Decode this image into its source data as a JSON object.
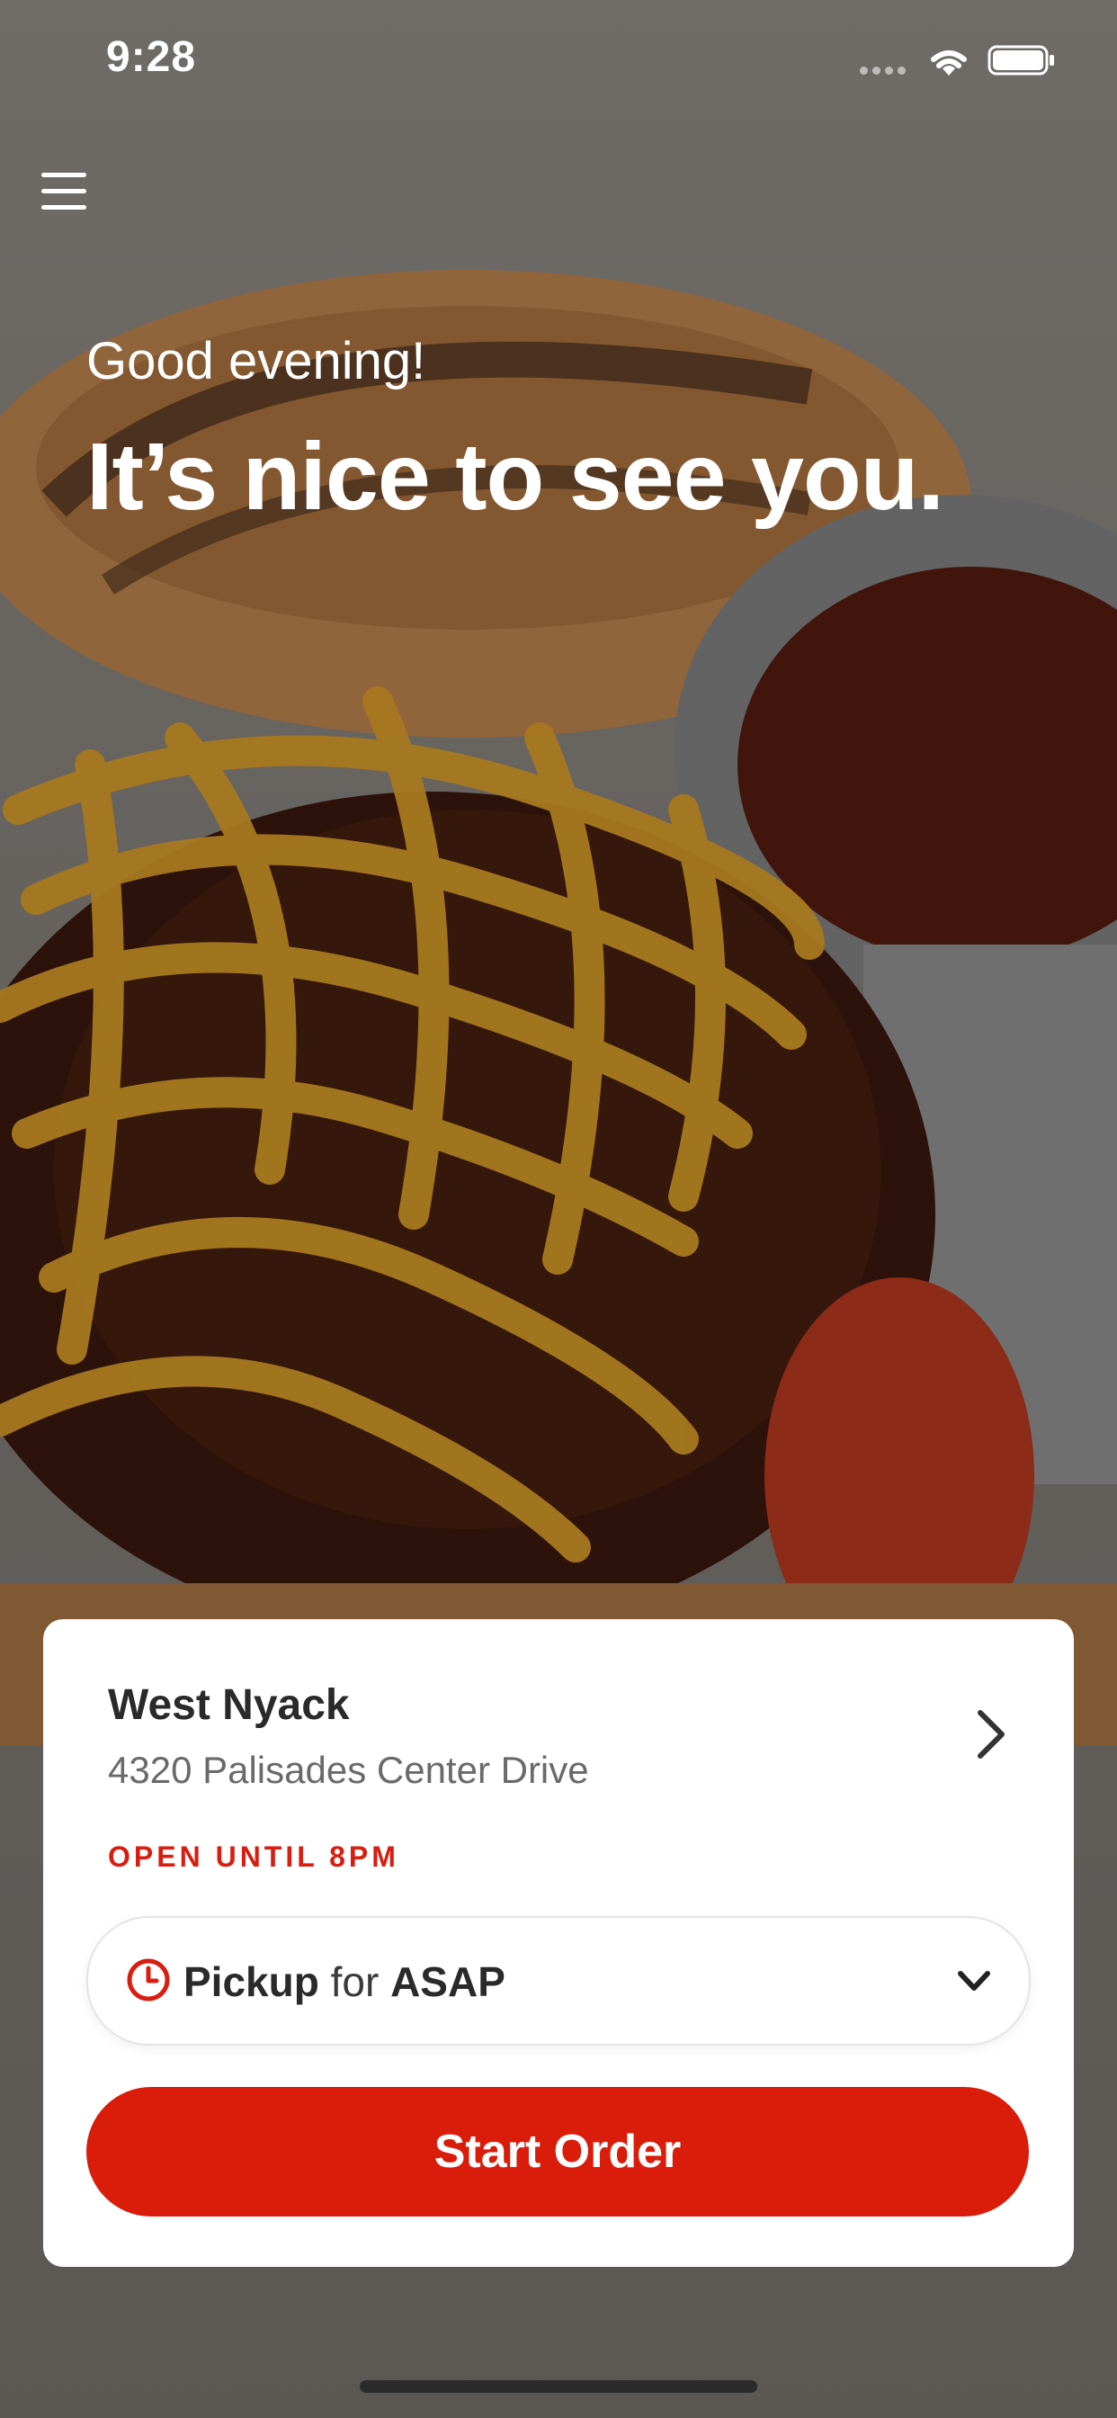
{
  "status_bar": {
    "time": "9:28"
  },
  "greeting": {
    "small": "Good evening!",
    "large": "It’s nice to see you."
  },
  "location": {
    "name": "West Nyack",
    "address": "4320 Palisades Center Drive",
    "hours": "OPEN UNTIL 8PM"
  },
  "order_mode": {
    "mode": "Pickup",
    "connector": "for",
    "time": "ASAP"
  },
  "actions": {
    "start_order": "Start Order"
  },
  "colors": {
    "accent": "#da1c0b",
    "hours_text": "#d81e10"
  },
  "icons": {
    "menu": "hamburger-menu-icon",
    "chevron_right": "chevron-right-icon",
    "clock": "clock-icon",
    "chevron_down": "chevron-down-icon"
  }
}
